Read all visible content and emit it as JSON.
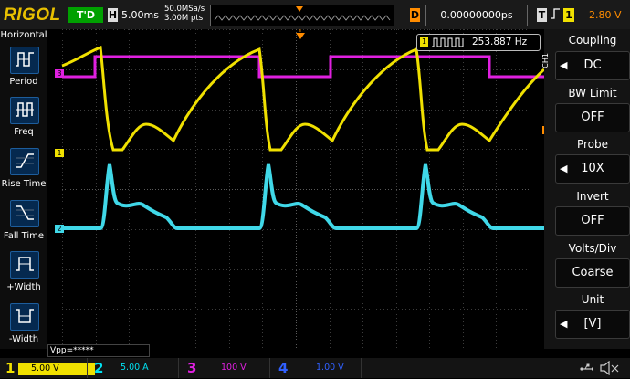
{
  "header": {
    "brand": "RIGOL",
    "run_status": "T'D",
    "timebase_label": "H",
    "timebase": "5.00ms",
    "sample_rate": "50.0MSa/s",
    "memory_depth": "3.00M pts",
    "trigger_delay_label": "D",
    "trigger_delay": "0.00000000ps",
    "trigger_label": "T",
    "trigger_edge": "f",
    "trigger_source": "1",
    "trigger_level": "2.80 V"
  },
  "left_menu": {
    "title": "Horizontal",
    "items": [
      {
        "label": "Period",
        "icon": "period-icon"
      },
      {
        "label": "Freq",
        "icon": "freq-icon"
      },
      {
        "label": "Rise Time",
        "icon": "rise-time-icon"
      },
      {
        "label": "Fall Time",
        "icon": "fall-time-icon"
      },
      {
        "label": "+Width",
        "icon": "positive-width-icon"
      },
      {
        "label": "-Width",
        "icon": "negative-width-icon"
      }
    ]
  },
  "measurements": {
    "frequency": "253.887 Hz",
    "vpp": "Vpp=*****"
  },
  "waveform_markers": {
    "ch1": "1",
    "ch2": "2",
    "ch3": "3",
    "trigger": "T"
  },
  "right_menu": {
    "channel_tag": "CH1",
    "items": [
      {
        "title": "Coupling",
        "value": "DC",
        "has_arrow": true
      },
      {
        "title": "BW Limit",
        "value": "OFF",
        "has_arrow": false
      },
      {
        "title": "Probe",
        "value": "10X",
        "has_arrow": true
      },
      {
        "title": "Invert",
        "value": "OFF",
        "has_arrow": false
      },
      {
        "title": "Volts/Div",
        "value": "Coarse",
        "has_arrow": false
      },
      {
        "title": "Unit",
        "value": "[V]",
        "has_arrow": true
      }
    ]
  },
  "channels": [
    {
      "num": "1",
      "scale": "5.00 V",
      "color": "#f0e000"
    },
    {
      "num": "2",
      "scale": "5.00 A",
      "color": "#00e0f0"
    },
    {
      "num": "3",
      "scale": "100 V",
      "color": "#e020e0"
    },
    {
      "num": "4",
      "scale": "1.00 V",
      "color": "#3060ff"
    }
  ],
  "colors": {
    "ch1": "#f0e000",
    "ch2": "#40d8e8",
    "ch3": "#e020e0",
    "trigger": "#ff8c00",
    "menu_blue": "#05294f"
  }
}
